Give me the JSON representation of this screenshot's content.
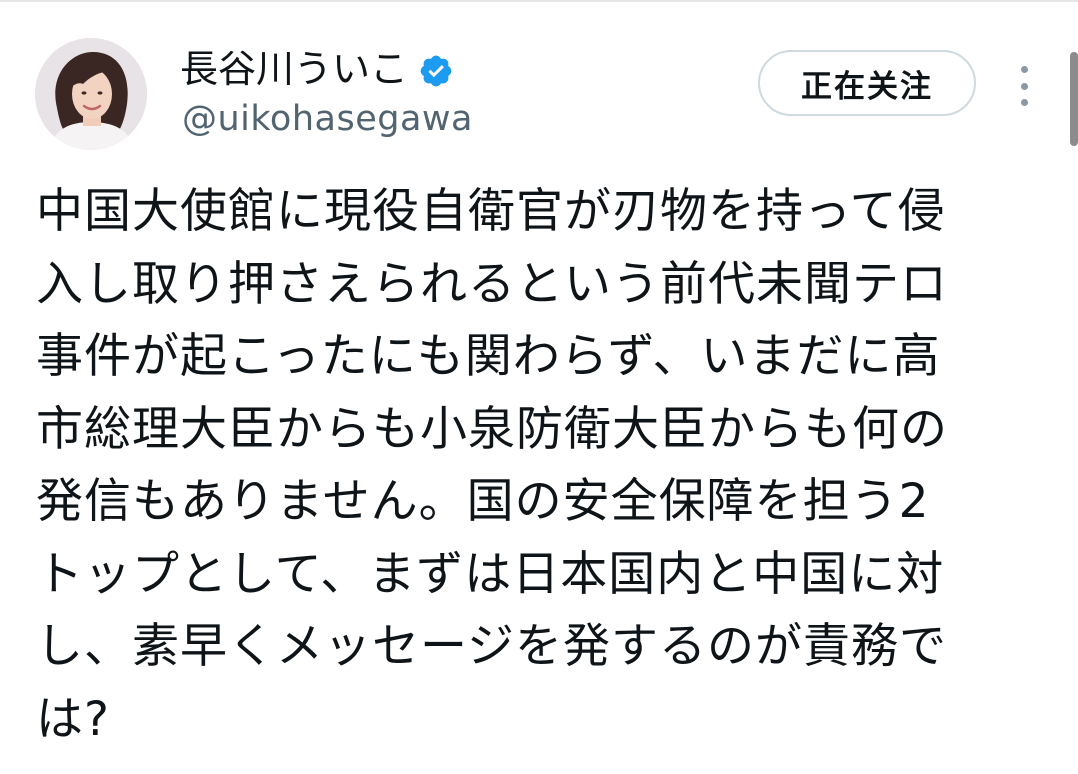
{
  "author": {
    "display_name": "長谷川ういこ",
    "handle": "@uikohasegawa",
    "verified": true
  },
  "actions": {
    "follow_label": "正在关注"
  },
  "icons": {
    "verified": "verified-badge-icon",
    "more": "more-vertical-icon"
  },
  "colors": {
    "verified_blue": "#1d9bf0",
    "text_primary": "#0f1419",
    "text_secondary": "#536471",
    "button_border": "#cfd9de"
  },
  "tweet": {
    "lines": [
      "中国大使館に現役自衛官が刃物を持って侵",
      "入し取り押さえられるという前代未聞テロ",
      "事件が起こったにも関わらず、いまだに高",
      "市総理大臣からも小泉防衛大臣からも何の",
      "発信もありません。国の安全保障を担う2",
      "トップとして、まずは日本国内と中国に対",
      "し、素早くメッセージを発するのが責務で",
      "は?"
    ]
  }
}
